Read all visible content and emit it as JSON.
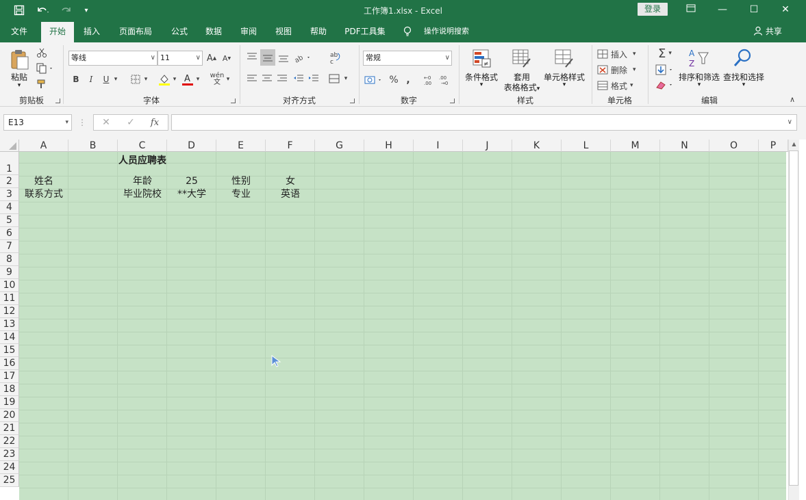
{
  "window": {
    "title": "工作簿1.xlsx  -  Excel",
    "login_label": "登录",
    "colors": {
      "brand": "#217346",
      "grid_bg": "#c6e2c6"
    }
  },
  "tabs": [
    "文件",
    "开始",
    "插入",
    "页面布局",
    "公式",
    "数据",
    "审阅",
    "视图",
    "帮助",
    "PDF工具集"
  ],
  "tell_me": "操作说明搜索",
  "share_label": "共享",
  "ribbon": {
    "clipboard": {
      "paste": "粘贴",
      "label": "剪贴板"
    },
    "font": {
      "name": "等线",
      "size": "11",
      "bold": "B",
      "italic": "I",
      "underline": "U",
      "wen": "wén",
      "label": "字体"
    },
    "alignment": {
      "label": "对齐方式"
    },
    "number": {
      "format": "常规",
      "percent": "%",
      "comma": ",",
      "label": "数字"
    },
    "styles": {
      "conditional": "条件格式",
      "table_line1": "套用",
      "table_line2": "表格格式",
      "cell_styles": "单元格样式",
      "label": "样式"
    },
    "cells": {
      "insert": "插入",
      "delete": "删除",
      "format": "格式",
      "label": "单元格"
    },
    "editing": {
      "sort": "排序和筛选",
      "find": "查找和选择",
      "label": "编辑"
    }
  },
  "formula_bar": {
    "name_box": "E13",
    "fx": "fx",
    "formula": ""
  },
  "sheet": {
    "columns": [
      "A",
      "B",
      "C",
      "D",
      "E",
      "F",
      "G",
      "H",
      "I",
      "J",
      "K",
      "L",
      "M",
      "N",
      "O",
      "P"
    ],
    "rows": [
      "1",
      "2",
      "3",
      "4",
      "5",
      "6",
      "7",
      "8",
      "9",
      "10",
      "11",
      "12",
      "13",
      "14",
      "15",
      "16",
      "17",
      "18",
      "19",
      "20",
      "21",
      "22",
      "23",
      "24",
      "25"
    ],
    "cells": {
      "C1": "人员应聘表",
      "A2": "姓名",
      "C2": "年龄",
      "D2": "25",
      "E2": "性别",
      "F2": "女",
      "A3": "联系方式",
      "C3": "毕业院校",
      "D3": "**大学",
      "E3": "专业",
      "F3": "英语"
    }
  }
}
